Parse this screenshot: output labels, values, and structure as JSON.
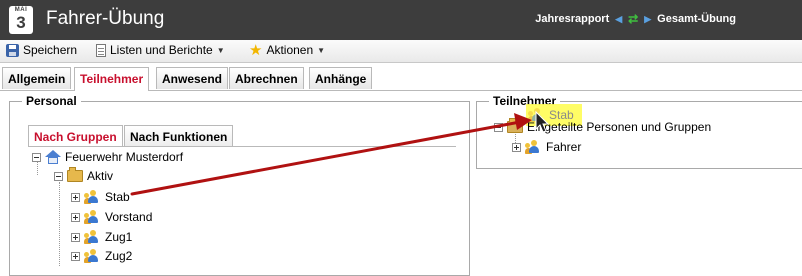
{
  "header": {
    "app_badge_top": "MAI",
    "app_badge_num": "3",
    "title": "Fahrer-Übung",
    "breadcrumb": {
      "left": "Jahresrapport",
      "right": "Gesamt-Übung"
    }
  },
  "toolbar": {
    "save": "Speichern",
    "lists": "Listen und Berichte",
    "actions": "Aktionen"
  },
  "tabs": [
    "Allgemein",
    "Teilnehmer",
    "Anwesend",
    "Abrechnen",
    "Anhänge"
  ],
  "active_tab": "Teilnehmer",
  "personal": {
    "legend": "Personal",
    "subtabs": [
      "Nach Gruppen",
      "Nach Funktionen"
    ],
    "tree": {
      "root": "Feuerwehr Musterdorf",
      "folder": "Aktiv",
      "groups": [
        "Stab",
        "Vorstand",
        "Zug1",
        "Zug2"
      ]
    }
  },
  "teilnehmer": {
    "legend": "Teilnehmer",
    "dragged_item": "Stab",
    "root": "Eingeteilte Personen und Gruppen",
    "groups": [
      "Fahrer"
    ]
  },
  "colors": {
    "accent": "#c8102e",
    "titlebar": "#3d3d3d",
    "highlight": "#fffd54",
    "arrow": "#b01111"
  },
  "icons": [
    "app-icon",
    "save-icon",
    "document-icon",
    "star-icon",
    "refresh-icon",
    "home-icon",
    "folder-icon",
    "group-icon"
  ]
}
